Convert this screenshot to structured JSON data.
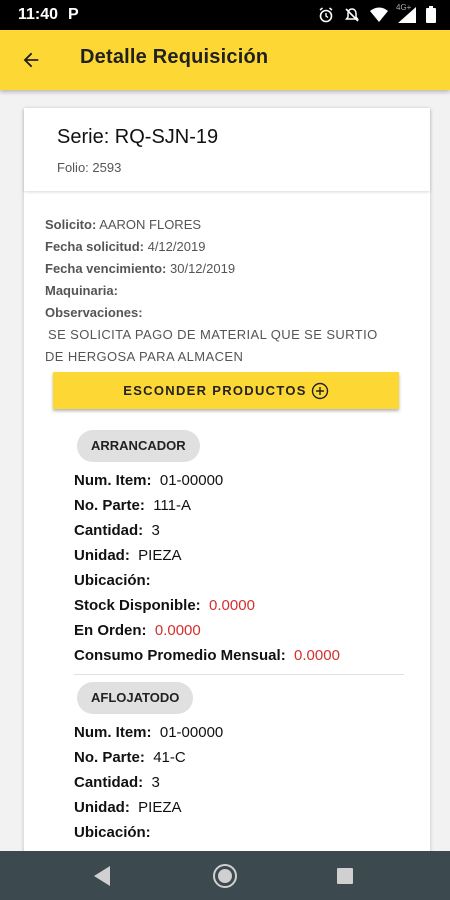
{
  "status_bar": {
    "time": "11:40",
    "app_icon": "P",
    "signal_label": "4G+"
  },
  "appbar": {
    "title": "Detalle Requisición"
  },
  "header": {
    "serie": "Serie: RQ-SJN-19",
    "folio": "Folio: 2593"
  },
  "info": {
    "solicito_label": "Solicito:",
    "solicito_value": "AARON FLORES",
    "fecha_solicitud_label": "Fecha solicitud:",
    "fecha_solicitud_value": "4/12/2019",
    "fecha_vencimiento_label": "Fecha vencimiento:",
    "fecha_vencimiento_value": "30/12/2019",
    "maquinaria_label": "Maquinaria:",
    "observaciones_label": "Observaciones:",
    "observaciones_line1": "SE SOLICITA PAGO DE MATERIAL QUE SE SURTIO",
    "observaciones_line2": "DE HERGOSA PARA ALMACEN"
  },
  "toggle_button": {
    "label": "ESCONDER PRODUCTOS"
  },
  "labels": {
    "num_item": "Num. Item:",
    "no_parte": "No. Parte:",
    "cantidad": "Cantidad:",
    "unidad": "Unidad:",
    "ubicacion": "Ubicación:",
    "stock": "Stock Disponible:",
    "en_orden": "En Orden:",
    "consumo": "Consumo Promedio Mensual:"
  },
  "products": [
    {
      "name": "ARRANCADOR",
      "num_item": "01-00000",
      "no_parte": "111-A",
      "cantidad": "3",
      "unidad": "PIEZA",
      "ubicacion": "",
      "stock": "0.0000",
      "en_orden": "0.0000",
      "consumo": "0.0000"
    },
    {
      "name": "AFLOJATODO",
      "num_item": "01-00000",
      "no_parte": "41-C",
      "cantidad": "3",
      "unidad": "PIEZA",
      "ubicacion": ""
    }
  ]
}
